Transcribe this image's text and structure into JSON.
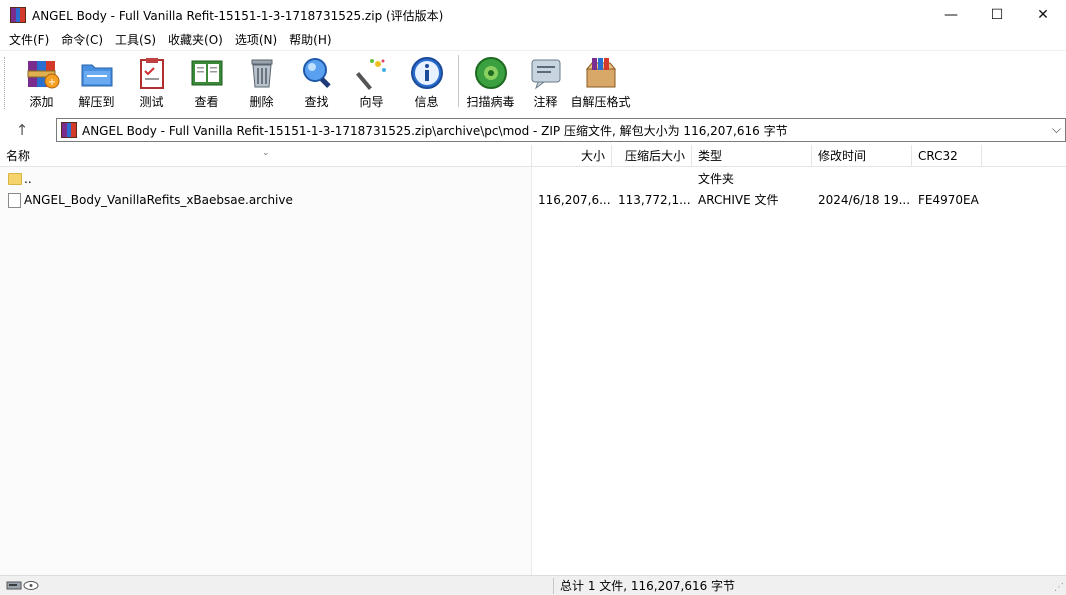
{
  "window": {
    "title": "ANGEL Body - Full Vanilla Refit-15151-1-3-1718731525.zip (评估版本)",
    "controls": {
      "minimize": "—",
      "maximize": "☐",
      "close": "✕"
    }
  },
  "menu": [
    "文件(F)",
    "命令(C)",
    "工具(S)",
    "收藏夹(O)",
    "选项(N)",
    "帮助(H)"
  ],
  "toolbar": {
    "buttons": [
      {
        "label": "添加",
        "icon": "add-archive-icon"
      },
      {
        "label": "解压到",
        "icon": "extract-to-icon"
      },
      {
        "label": "测试",
        "icon": "test-icon"
      },
      {
        "label": "查看",
        "icon": "view-icon"
      },
      {
        "label": "删除",
        "icon": "delete-icon"
      },
      {
        "label": "查找",
        "icon": "find-icon"
      },
      {
        "label": "向导",
        "icon": "wizard-icon"
      },
      {
        "label": "信息",
        "icon": "info-icon"
      },
      {
        "label": "扫描病毒",
        "icon": "virus-scan-icon"
      },
      {
        "label": "注释",
        "icon": "comment-icon"
      },
      {
        "label": "自解压格式",
        "icon": "sfx-icon"
      }
    ]
  },
  "address": {
    "path": "ANGEL Body - Full Vanilla Refit-15151-1-3-1718731525.zip\\archive\\pc\\mod - ZIP 压缩文件, 解包大小为 116,207,616 字节",
    "up_label": "↑",
    "dropdown": "⌵"
  },
  "columns": {
    "name": "名称",
    "size": "大小",
    "packed": "压缩后大小",
    "type": "类型",
    "modified": "修改时间",
    "crc": "CRC32"
  },
  "rows": [
    {
      "name": "..",
      "size": "",
      "packed": "",
      "type": "文件夹",
      "modified": "",
      "crc": ""
    },
    {
      "name": "ANGEL_Body_VanillaRefits_xBaebsae.archive",
      "size": "116,207,6...",
      "packed": "113,772,1...",
      "type": "ARCHIVE 文件",
      "modified": "2024/6/18 19...",
      "crc": "FE4970EA"
    }
  ],
  "status": {
    "summary": "总计 1 文件, 116,207,616 字节"
  },
  "colors": {
    "accent": "#2a6fd0",
    "status_bg": "#f0f0f0"
  }
}
